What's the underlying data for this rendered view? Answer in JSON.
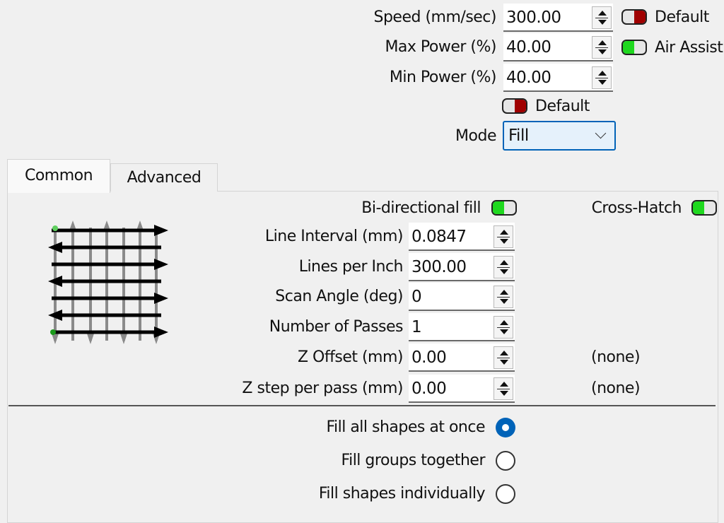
{
  "top": {
    "speed": {
      "label": "Speed (mm/sec)",
      "value": "300.00"
    },
    "max_power": {
      "label": "Max Power (%)",
      "value": "40.00"
    },
    "min_power": {
      "label": "Min Power (%)",
      "value": "40.00"
    },
    "speed_default": {
      "label": "Default",
      "state": "off"
    },
    "air_assist": {
      "label": "Air Assist",
      "state": "on"
    },
    "power_default": {
      "label": "Default",
      "state": "off"
    },
    "mode": {
      "label": "Mode",
      "value": "Fill"
    }
  },
  "tabs": [
    {
      "label": "Common",
      "active": true
    },
    {
      "label": "Advanced",
      "active": false
    }
  ],
  "common": {
    "bidirectional_fill": {
      "label": "Bi-directional fill",
      "state": "on"
    },
    "cross_hatch": {
      "label": "Cross-Hatch",
      "state": "on"
    },
    "fields": [
      {
        "label": "Line Interval (mm)",
        "value": "0.0847",
        "note": ""
      },
      {
        "label": "Lines per Inch",
        "value": "300.00",
        "note": ""
      },
      {
        "label": "Scan Angle (deg)",
        "value": "0",
        "note": ""
      },
      {
        "label": "Number of Passes",
        "value": "1",
        "note": ""
      },
      {
        "label": "Z Offset (mm)",
        "value": "0.00",
        "note": "(none)"
      },
      {
        "label": "Z step per pass (mm)",
        "value": "0.00",
        "note": "(none)"
      }
    ],
    "fill_options": [
      {
        "label": "Fill all shapes at once",
        "checked": true
      },
      {
        "label": "Fill groups together",
        "checked": false
      },
      {
        "label": "Fill shapes individually",
        "checked": false
      }
    ]
  },
  "colors": {
    "toggle_on": "#1fd81f",
    "toggle_off": "#a00000",
    "accent": "#0063b8"
  }
}
